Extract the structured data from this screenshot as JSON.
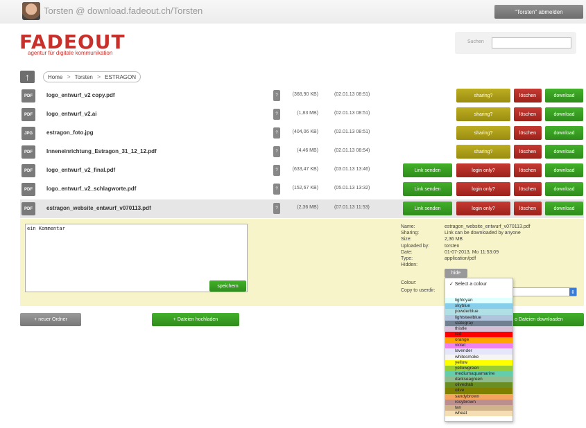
{
  "top": {
    "title": "Torsten @ download.fadeout.ch/Torsten",
    "logout_label": "\"Torsten\" abmelden"
  },
  "brand": {
    "logo": "FADEOUT",
    "tagline": "agentur für digitale kommunikation"
  },
  "search": {
    "label": "Suchen",
    "value": ""
  },
  "nav": {
    "up_icon": "arrow-up-icon",
    "breadcrumb": [
      "Home",
      "Torsten",
      "ESTRAGON"
    ]
  },
  "files": [
    {
      "icon": "PDF",
      "name": "logo_entwurf_v2 copy.pdf",
      "info": "?",
      "size": "(368,90 KB)",
      "date": "(02.01.13 08:51)",
      "share_label": "sharing?",
      "delete_label": "löschen",
      "download_label": "download"
    },
    {
      "icon": "PDF",
      "name": "logo_entwurf_v2.ai",
      "info": "?",
      "size": "(1,83 MB)",
      "date": "(02.01.13 08:51)",
      "share_label": "sharing?",
      "delete_label": "löschen",
      "download_label": "download"
    },
    {
      "icon": "JPG",
      "name": "estragon_foto.jpg",
      "info": "?",
      "size": "(404,06 KB)",
      "date": "(02.01.13 08:51)",
      "share_label": "sharing?",
      "delete_label": "löschen",
      "download_label": "download"
    },
    {
      "icon": "PDF",
      "name": "Inneneinrichtung_Estragon_31_12_12.pdf",
      "info": "?",
      "size": "(4,46 MB)",
      "date": "(02.01.13 08:54)",
      "share_label": "sharing?",
      "delete_label": "löschen",
      "download_label": "download"
    },
    {
      "icon": "PDF",
      "name": "logo_entwurf_v2_final.pdf",
      "info": "?",
      "size": "(633,47 KB)",
      "date": "(03.01.13 13:46)",
      "link_label": "Link senden",
      "share_label": "login only?",
      "delete_label": "löschen",
      "download_label": "download"
    },
    {
      "icon": "PDF",
      "name": "logo_entwurf_v2_schlagworte.pdf",
      "info": "?",
      "size": "(152,67 KB)",
      "date": "(05.01.13 13:32)",
      "link_label": "Link senden",
      "share_label": "login only?",
      "delete_label": "löschen",
      "download_label": "download"
    },
    {
      "icon": "PDF",
      "name": "estragon_website_entwurf_v070113.pdf",
      "info": "?",
      "size": "(2,36 MB)",
      "date": "(07.01.13 11:53)",
      "link_label": "Link senden",
      "share_label": "login only?",
      "delete_label": "löschen",
      "download_label": "download"
    }
  ],
  "detail": {
    "comment": "ein Kommentar",
    "save_label": "speichern",
    "labels": [
      "Name:",
      "Sharing:",
      "Size:",
      "Uploaded by:",
      "Date:",
      "Type:",
      "Hidden:"
    ],
    "values": [
      "estragon_website_entwurf_v070113.pdf",
      "Link can be downloaded by anyone",
      "2,36 MB",
      "torsten",
      "01-07-2013, Mo 11:53:09",
      "application/pdf"
    ],
    "hide_label": "hide",
    "colour_label": "Colour:",
    "copy_label": "Copy to userdir:"
  },
  "bottom": {
    "new_folder_label": "+ neuer Ordner",
    "upload_label": "+ Dateien hochladen",
    "download_all_label": "o Dateien downloaden"
  },
  "colour_dropdown": {
    "selected": "✓ Select a colour",
    "options": [
      {
        "label": "",
        "color": "#ffffff"
      },
      {
        "label": "lightcyan",
        "color": "#e0ffff"
      },
      {
        "label": "skyblue",
        "color": "#87ceeb"
      },
      {
        "label": "powderblue",
        "color": "#b0e0e6"
      },
      {
        "label": "lightsteelblue",
        "color": "#b0c4de"
      },
      {
        "label": "slategray",
        "color": "#708090"
      },
      {
        "label": "thistle",
        "color": "#d8bfd8"
      },
      {
        "label": "red",
        "color": "#ff0000"
      },
      {
        "label": "orange",
        "color": "#ffa500"
      },
      {
        "label": "violet",
        "color": "#ee82ee"
      },
      {
        "label": "lavender",
        "color": "#e6e6fa"
      },
      {
        "label": "whitesmoke",
        "color": "#f5f5f5"
      },
      {
        "label": "yellow",
        "color": "#ffff00"
      },
      {
        "label": "yellowgreen",
        "color": "#9acd32"
      },
      {
        "label": "mediumaquamarine",
        "color": "#66cdaa"
      },
      {
        "label": "darkseagreen",
        "color": "#8fbc8f"
      },
      {
        "label": "olivedrab",
        "color": "#6b8e23"
      },
      {
        "label": "olive",
        "color": "#808000"
      },
      {
        "label": "sandybrown",
        "color": "#f4a460"
      },
      {
        "label": "rosybrown",
        "color": "#bc8f8f"
      },
      {
        "label": "tan",
        "color": "#d2b48c"
      },
      {
        "label": "wheat",
        "color": "#f5deb3"
      }
    ]
  }
}
